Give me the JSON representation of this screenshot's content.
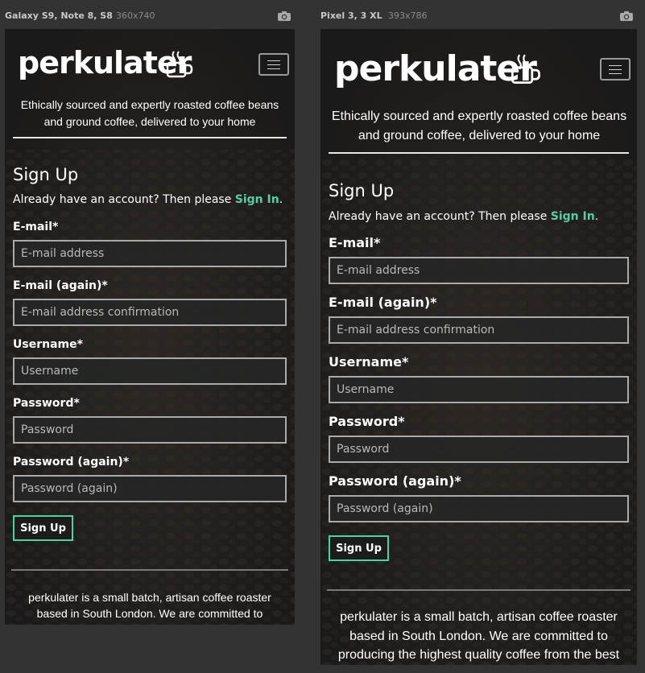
{
  "devices": [
    {
      "name": "Galaxy S9, Note 8, S8",
      "dims": "360x740",
      "page": {
        "logo": "perkulater",
        "tagline": "Ethically sourced and expertly roasted coffee beans and ground coffee, delivered to your home",
        "heading": "Sign Up",
        "account_text": "Already have an account? Then please ",
        "sign_in_link": "Sign In",
        "account_end": ".",
        "fields": [
          {
            "label": "E-mail*",
            "placeholder": "E-mail address"
          },
          {
            "label": "E-mail (again)*",
            "placeholder": "E-mail address confirmation"
          },
          {
            "label": "Username*",
            "placeholder": "Username"
          },
          {
            "label": "Password*",
            "placeholder": "Password"
          },
          {
            "label": "Password (again)*",
            "placeholder": "Password (again)"
          }
        ],
        "button": "Sign Up",
        "footer": "perkulater is a small batch, artisan coffee roaster based in South London. We are committed to producing the"
      }
    },
    {
      "name": "Pixel 3, 3 XL",
      "dims": "393x786",
      "page": {
        "logo": "perkulater",
        "tagline": "Ethically sourced and expertly roasted coffee beans and ground coffee, delivered to your home",
        "heading": "Sign Up",
        "account_text": "Already have an account? Then please ",
        "sign_in_link": "Sign In",
        "account_end": ".",
        "fields": [
          {
            "label": "E-mail*",
            "placeholder": "E-mail address"
          },
          {
            "label": "E-mail (again)*",
            "placeholder": "E-mail address confirmation"
          },
          {
            "label": "Username*",
            "placeholder": "Username"
          },
          {
            "label": "Password*",
            "placeholder": "Password"
          },
          {
            "label": "Password (again)*",
            "placeholder": "Password (again)"
          }
        ],
        "button": "Sign Up",
        "footer": "perkulater is a small batch, artisan coffee roaster based in South London. We are committed to producing the highest quality coffee from the best quality beans."
      }
    }
  ],
  "colors": {
    "accent": "#4fd1a5",
    "background": "#333333",
    "screen": "#232323"
  },
  "icons": {
    "camera": "camera-icon",
    "menu": "hamburger-menu-icon",
    "cup": "coffee-cup-icon"
  }
}
